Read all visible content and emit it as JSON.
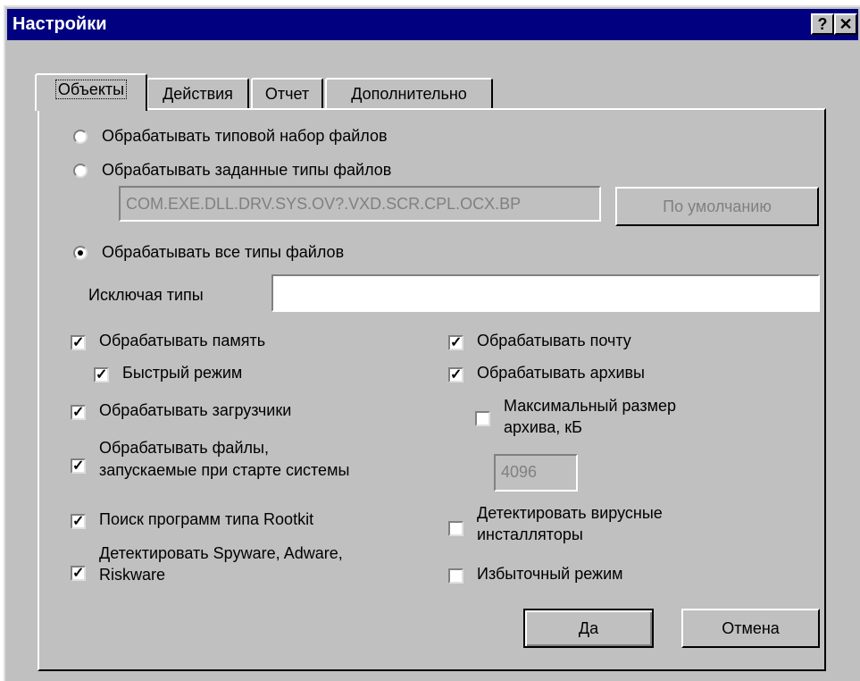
{
  "window": {
    "title": "Настройки",
    "help_button": "?",
    "close_button": "✕"
  },
  "tabs": [
    {
      "label": "Объекты",
      "active": true
    },
    {
      "label": "Действия",
      "active": false
    },
    {
      "label": "Отчет",
      "active": false
    },
    {
      "label": "Дополнительно",
      "active": false
    }
  ],
  "processing": {
    "radio_typical": {
      "label": "Обрабатывать типовой набор файлов",
      "selected": false
    },
    "radio_specified": {
      "label": "Обрабатывать заданные типы файлов",
      "selected": false
    },
    "extensions_value": "COM.EXE.DLL.DRV.SYS.OV?.VXD.SCR.CPL.OCX.BP",
    "default_button": "По умолчанию",
    "radio_all": {
      "label": "Обрабатывать все типы файлов",
      "selected": true
    },
    "exclude_label": "Исключая типы",
    "exclude_value": ""
  },
  "left_options": {
    "memory": {
      "label": "Обрабатывать память",
      "checked": true
    },
    "fast_mode": {
      "label": "Быстрый режим",
      "checked": true
    },
    "boot": {
      "label": "Обрабатывать загрузчики",
      "checked": true
    },
    "startup_line1": "Обрабатывать файлы,",
    "startup_line2": "запускаемые при старте системы",
    "startup_checked": true,
    "rootkit": {
      "label": "Поиск программ типа Rootkit",
      "checked": true
    },
    "spyware_line1": "Детектировать Spyware, Adware,",
    "spyware_line2": "Riskware",
    "spyware_checked": true
  },
  "right_options": {
    "mail": {
      "label": "Обрабатывать почту",
      "checked": true
    },
    "archives": {
      "label": "Обрабатывать архивы",
      "checked": true
    },
    "maxsize_line1": "Максимальный размер",
    "maxsize_line2": "архива, кБ",
    "maxsize_checked": false,
    "maxsize_value": "4096",
    "installers_line1": "Детектировать вирусные",
    "installers_line2": "инсталляторы",
    "installers_checked": false,
    "redundant": {
      "label": "Избыточный режим",
      "checked": false
    }
  },
  "buttons": {
    "ok": "Да",
    "cancel": "Отмена"
  },
  "colors": {
    "titlebar": "#000080",
    "face": "#c0c0c0"
  }
}
